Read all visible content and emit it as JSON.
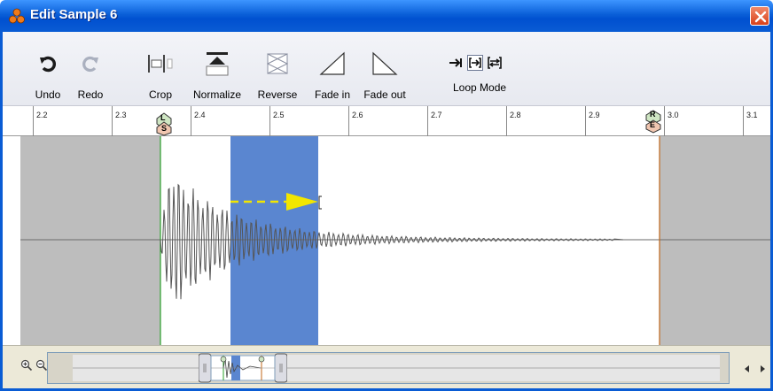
{
  "window": {
    "title": "Edit Sample 6",
    "close_icon": "close-icon"
  },
  "toolbar": {
    "undo_label": "Undo",
    "redo_label": "Redo",
    "crop_label": "Crop",
    "normalize_label": "Normalize",
    "reverse_label": "Reverse",
    "fade_in_label": "Fade in",
    "fade_out_label": "Fade out",
    "loop_mode_label": "Loop Mode"
  },
  "ruler": {
    "ticks": [
      "2.2",
      "2.3",
      "2.4",
      "2.5",
      "2.6",
      "2.7",
      "2.8",
      "2.9",
      "3.0",
      "3.1"
    ]
  },
  "markers": {
    "left_loop": "L",
    "start": "S",
    "right_loop": "R",
    "end": "E"
  },
  "colors": {
    "selection": "#5a86d0",
    "out_of_range": "#bdbdbd",
    "arrow": "#f2e600",
    "titlebar": "#0a5cd4",
    "marker_line_left": "#2aa02a",
    "marker_line_right": "#c0671a"
  }
}
